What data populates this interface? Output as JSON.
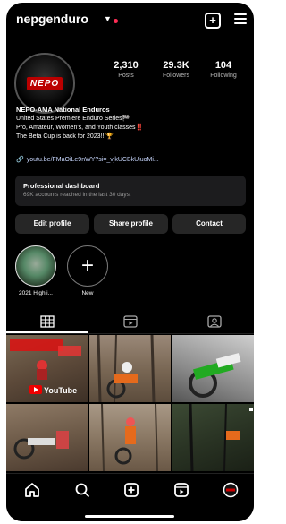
{
  "header": {
    "username": "nepgenduro"
  },
  "stats": [
    {
      "value": "2,310",
      "label": "Posts"
    },
    {
      "value": "29.3K",
      "label": "Followers"
    },
    {
      "value": "104",
      "label": "Following"
    }
  ],
  "avatar": {
    "logo_text": "NEPO"
  },
  "bio": {
    "name": "NEPO-AMA National Enduros",
    "line1": "United States Premiere Enduro Series🏁",
    "line2": "Pro, Amateur, Women's, and Youth classes‼️",
    "line3": "The Beta Cup is back for 2023!! 🏆",
    "link": "youtu.be/FMaOiLe9nWY?si=_vjkUCBkUiuoMi..."
  },
  "dashboard": {
    "title": "Professional dashboard",
    "subtitle": "69K accounts reached in the last 30 days."
  },
  "buttons": {
    "edit": "Edit profile",
    "share": "Share profile",
    "contact": "Contact"
  },
  "highlights": [
    {
      "label": "2021 Highli..."
    },
    {
      "label": "New"
    }
  ],
  "grid_tiles": [
    {
      "text": "YouTube"
    }
  ],
  "colors": {
    "background": "#000000",
    "accent": "#ff2d55",
    "button": "#262626"
  }
}
